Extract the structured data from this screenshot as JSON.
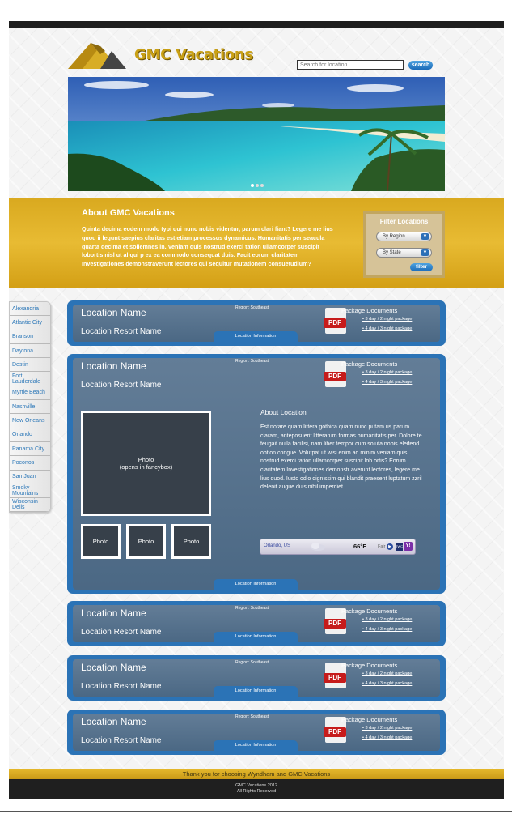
{
  "header": {
    "brand": "GMC Vacations",
    "search_placeholder": "Search for location...",
    "search_label": "search"
  },
  "hero": {
    "slides": 3,
    "active_slide": 1
  },
  "about": {
    "title": "About GMC Vacations",
    "text": "Quinta decima eodem modo typi qui nunc nobis videntur, parum clari fiant? Legere me lius quod ii legunt saepius claritas est etiam processus dynamicus. Humanitatis per seacula quarta decima et sollemnes in. Veniam quis nostrud exerci tation ullamcorper suscipit lobortis nisl ut aliqui p ex ea commodo consequat duis. Facit eorum claritatem Investigationes demonstraverunt lectores qui sequitur mutationem consuetudium?"
  },
  "filter": {
    "title": "Filter Locations",
    "region_label": "By Region",
    "state_label": "By State",
    "button": "filter"
  },
  "sidebar": {
    "items": [
      "Alexandria",
      "Atlantic City",
      "Branson",
      "Daytona",
      "Destin",
      "Fort Lauderdale",
      "Myrtle Beach",
      "Nashville",
      "New Orleans",
      "Orlando",
      "Panama City",
      "Poconos",
      "San Juan",
      "Smoky Mountains",
      "Wisconsin Dells"
    ]
  },
  "card": {
    "location_name": "Location Name",
    "resort_name": "Location Resort Name",
    "region": "Region: Southeast",
    "pdf_label": "PDF",
    "package_title": "Package Documents",
    "package_link_1": "• 3 day / 2 night package",
    "package_link_2": "• 4 day / 3 night package",
    "info_tab": "Location Information"
  },
  "expanded": {
    "main_photo_line1": "Photo",
    "main_photo_line2": "(opens in fancybox)",
    "thumb_label": "Photo",
    "about_title": "About Location",
    "about_text": "Est notare quam littera gothica quam nunc putam us parum claram, anteposuerit litterarum formas humanitatis per. Dolore te feugait nulla facilisi, nam liber tempor cum soluta nobis eleifend option congue. Volutpat ut wisi enim ad minim veniam quis, nostrud exerci tation ullamcorper suscipit lob ortis? Eorum claritatem Investigationes demonstr averunt lectores, legere me lius quod. Iusto odio dignissim qui blandit praesent luptatum zzril delenit augue duis nihil imperdiet.",
    "weather": {
      "city": "Orlando, US",
      "temp": "66°F",
      "condition": "Fair",
      "twc": "TWC",
      "yahoo": "Y!"
    }
  },
  "footer": {
    "thanks": "Thank you for choosing Wyndham and GMC Vacations",
    "copyright": "GMC Vacations 2012",
    "rights": "All Rights Reserved"
  },
  "colors": {
    "gold": "#dcae24",
    "card_blue": "#2b73b6",
    "dark": "#1f1f1f"
  }
}
